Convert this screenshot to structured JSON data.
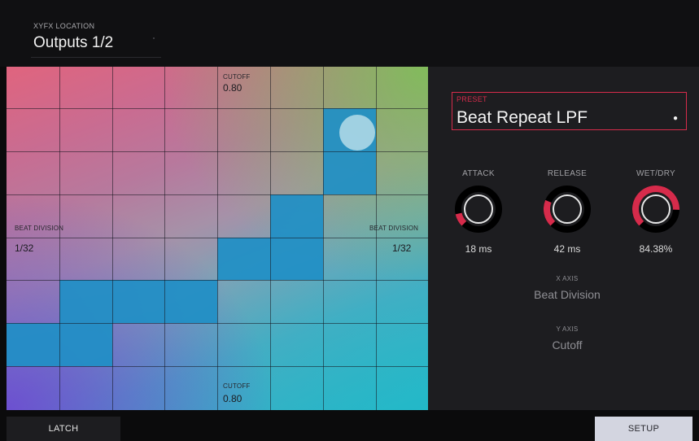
{
  "header": {
    "location_label": "XYFX LOCATION",
    "location_value": "Outputs 1/2"
  },
  "pad": {
    "top_param_label": "CUTOFF",
    "top_param_value": "0.80",
    "bottom_param_label": "CUTOFF",
    "bottom_param_value": "0.80",
    "left_param_label": "BEAT DIVISION",
    "left_param_value": "1/32",
    "right_param_label": "BEAT DIVISION",
    "right_param_value": "1/32"
  },
  "preset": {
    "label": "PRESET",
    "value": "Beat Repeat LPF"
  },
  "knobs": [
    {
      "label": "ATTACK",
      "value": "18 ms",
      "level": 0.12
    },
    {
      "label": "RELEASE",
      "value": "42 ms",
      "level": 0.25
    },
    {
      "label": "WET/DRY",
      "value": "84.38%",
      "level": 0.84
    }
  ],
  "axes": {
    "x_label": "X AXIS",
    "x_value": "Beat Division",
    "y_label": "Y AXIS",
    "y_value": "Cutoff"
  },
  "footer": {
    "latch_label": "LATCH",
    "setup_label": "SETUP"
  },
  "colors": {
    "accent": "#d62b4b",
    "cell_blue": "#1f8fc6"
  }
}
